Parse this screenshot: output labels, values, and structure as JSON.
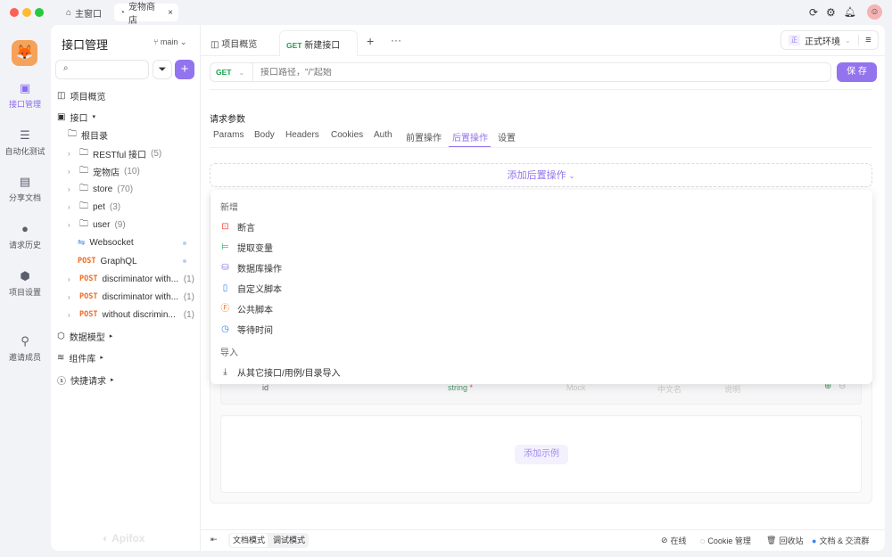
{
  "window": {
    "tabs": [
      {
        "label": "主窗口",
        "icon": "home-icon"
      },
      {
        "label": "宠物商店",
        "icon": "project-icon"
      }
    ],
    "close": "×"
  },
  "colors": {
    "accent": "#9373ee",
    "get": "#17a34a",
    "post": "#f06a1f",
    "bg": "#f2f3f7"
  },
  "rail": [
    {
      "label": "接口管理",
      "icon": "api-icon"
    },
    {
      "label": "自动化测试",
      "icon": "test-icon"
    },
    {
      "label": "分享文档",
      "icon": "book-icon"
    },
    {
      "label": "请求历史",
      "icon": "clock-icon"
    },
    {
      "label": "项目设置",
      "icon": "settings-icon"
    },
    {
      "label": "邀请成员",
      "icon": "add-user-icon"
    }
  ],
  "sidebar": {
    "title": "接口管理",
    "branch": "main",
    "overview": "项目概览",
    "api": "接口",
    "root": "根目录",
    "items": [
      {
        "name": "RESTful 接口",
        "count": "(5)"
      },
      {
        "name": "宠物店",
        "count": "(10)"
      },
      {
        "name": "store",
        "count": "(70)"
      },
      {
        "name": "pet",
        "count": "(3)"
      },
      {
        "name": "user",
        "count": "(9)"
      }
    ],
    "websocket": "Websocket",
    "graphql": {
      "method": "POST",
      "name": "GraphQL"
    },
    "posts": [
      {
        "method": "POST",
        "name": "discriminator with...",
        "count": "(1)"
      },
      {
        "method": "POST",
        "name": "discriminator with...",
        "count": "(1)"
      },
      {
        "method": "POST",
        "name": "without discrimin...",
        "count": "(1)"
      }
    ],
    "sections": [
      "数据模型",
      "组件库",
      "快捷请求"
    ],
    "logo": "Apifox"
  },
  "main": {
    "tabs": [
      {
        "label": "项目概览"
      },
      {
        "method": "GET",
        "label": "新建接口"
      }
    ],
    "env": {
      "badge": "正",
      "label": "正式环境"
    },
    "method": "GET",
    "url_placeholder": "接口路径，\"/\"起始",
    "save": "保 存",
    "params_title": "请求参数",
    "param_tabs": [
      "Params",
      "Body",
      "Headers",
      "Cookies",
      "Auth",
      "前置操作",
      "后置操作",
      "设置"
    ],
    "active_tab": "后置操作",
    "add_post": "添加后置操作",
    "menu": {
      "new_title": "新增",
      "items": [
        {
          "label": "断言",
          "icon": "assert-icon",
          "color": "#f0483e"
        },
        {
          "label": "提取变量",
          "icon": "extract-icon",
          "color": "#2fb36b"
        },
        {
          "label": "数据库操作",
          "icon": "database-icon",
          "color": "#8b6cf0"
        },
        {
          "label": "自定义脚本",
          "icon": "script-icon",
          "color": "#3b82f6"
        },
        {
          "label": "公共脚本",
          "icon": "public-script-icon",
          "color": "#f07a2a"
        },
        {
          "label": "等待时间",
          "icon": "clock-icon",
          "color": "#3b82f6"
        }
      ],
      "import_title": "导入",
      "import_item": "从其它接口/用例/目录导入"
    },
    "row": {
      "name": "id",
      "type": "string",
      "required": "*",
      "mock": "Mock",
      "cn": "中文名",
      "desc": "说明"
    },
    "add_example": "添加示例"
  },
  "footer": {
    "doc_mode": "文档模式",
    "debug_mode": "调试模式",
    "online": "在线",
    "cookie": "Cookie 管理",
    "trash": "回收站",
    "community": "文档 & 交流群"
  }
}
